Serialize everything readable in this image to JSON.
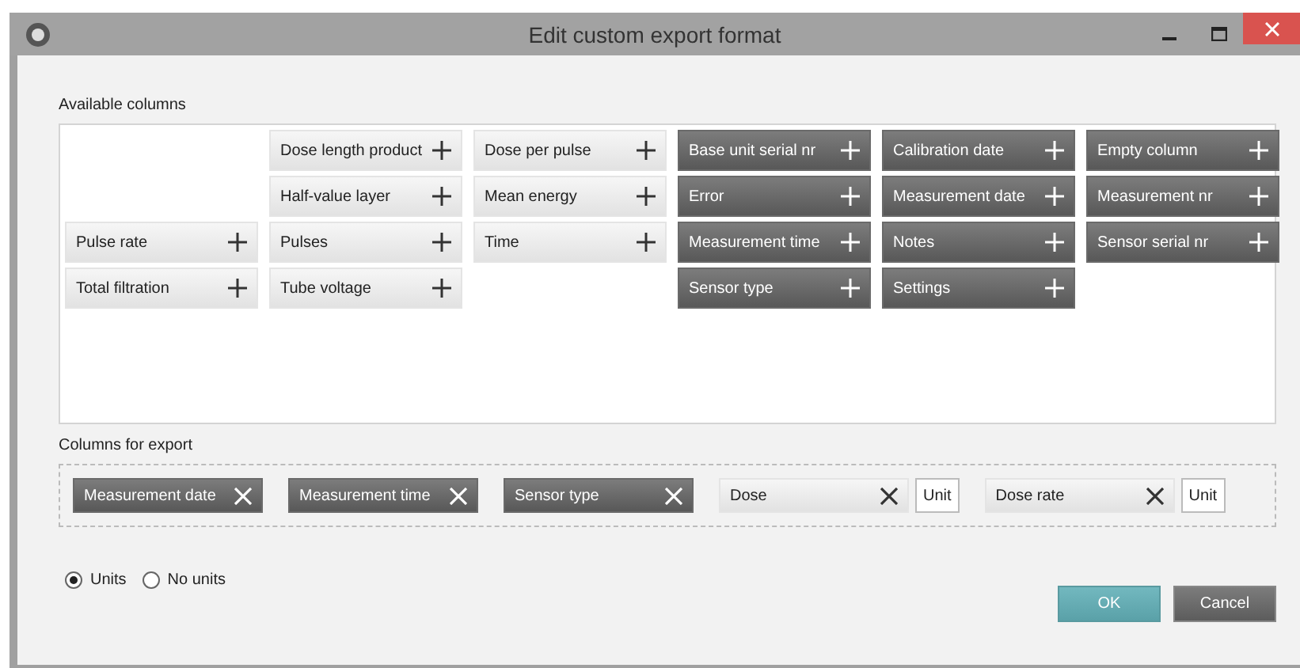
{
  "window": {
    "title": "Edit custom export format"
  },
  "available": {
    "label": "Available columns",
    "rows": [
      [
        null,
        {
          "label": "Dose length product",
          "kind": "light"
        },
        {
          "label": "Dose per pulse",
          "kind": "light"
        },
        {
          "label": "Base unit serial nr",
          "kind": "dark"
        },
        {
          "label": "Calibration date",
          "kind": "dark"
        },
        {
          "label": "Empty column",
          "kind": "dark"
        }
      ],
      [
        null,
        {
          "label": "Half-value layer",
          "kind": "light"
        },
        {
          "label": "Mean energy",
          "kind": "light"
        },
        {
          "label": "Error",
          "kind": "dark"
        },
        {
          "label": "Measurement date",
          "kind": "dark"
        },
        {
          "label": "Measurement nr",
          "kind": "dark"
        }
      ],
      [
        {
          "label": "Pulse rate",
          "kind": "light"
        },
        {
          "label": "Pulses",
          "kind": "light"
        },
        {
          "label": "Time",
          "kind": "light"
        },
        {
          "label": "Measurement time",
          "kind": "dark"
        },
        {
          "label": "Notes",
          "kind": "dark"
        },
        {
          "label": "Sensor serial nr",
          "kind": "dark"
        }
      ],
      [
        {
          "label": "Total filtration",
          "kind": "light"
        },
        {
          "label": "Tube voltage",
          "kind": "light"
        },
        null,
        {
          "label": "Sensor type",
          "kind": "dark"
        },
        {
          "label": "Settings",
          "kind": "dark"
        },
        null
      ]
    ]
  },
  "export": {
    "label": "Columns for export",
    "items": [
      {
        "label": "Measurement date",
        "kind": "dark"
      },
      {
        "label": "Measurement time",
        "kind": "dark"
      },
      {
        "label": "Sensor type",
        "kind": "dark"
      },
      {
        "label": "Dose",
        "kind": "light",
        "unit": "Unit"
      },
      {
        "label": "Dose rate",
        "kind": "light",
        "unit": "Unit"
      }
    ]
  },
  "unit_options": [
    {
      "label": "Units",
      "selected": true
    },
    {
      "label": "No units",
      "selected": false
    }
  ],
  "buttons": [
    {
      "label": "OK",
      "kind": "primary"
    },
    {
      "label": "Cancel",
      "kind": "secondary"
    }
  ]
}
